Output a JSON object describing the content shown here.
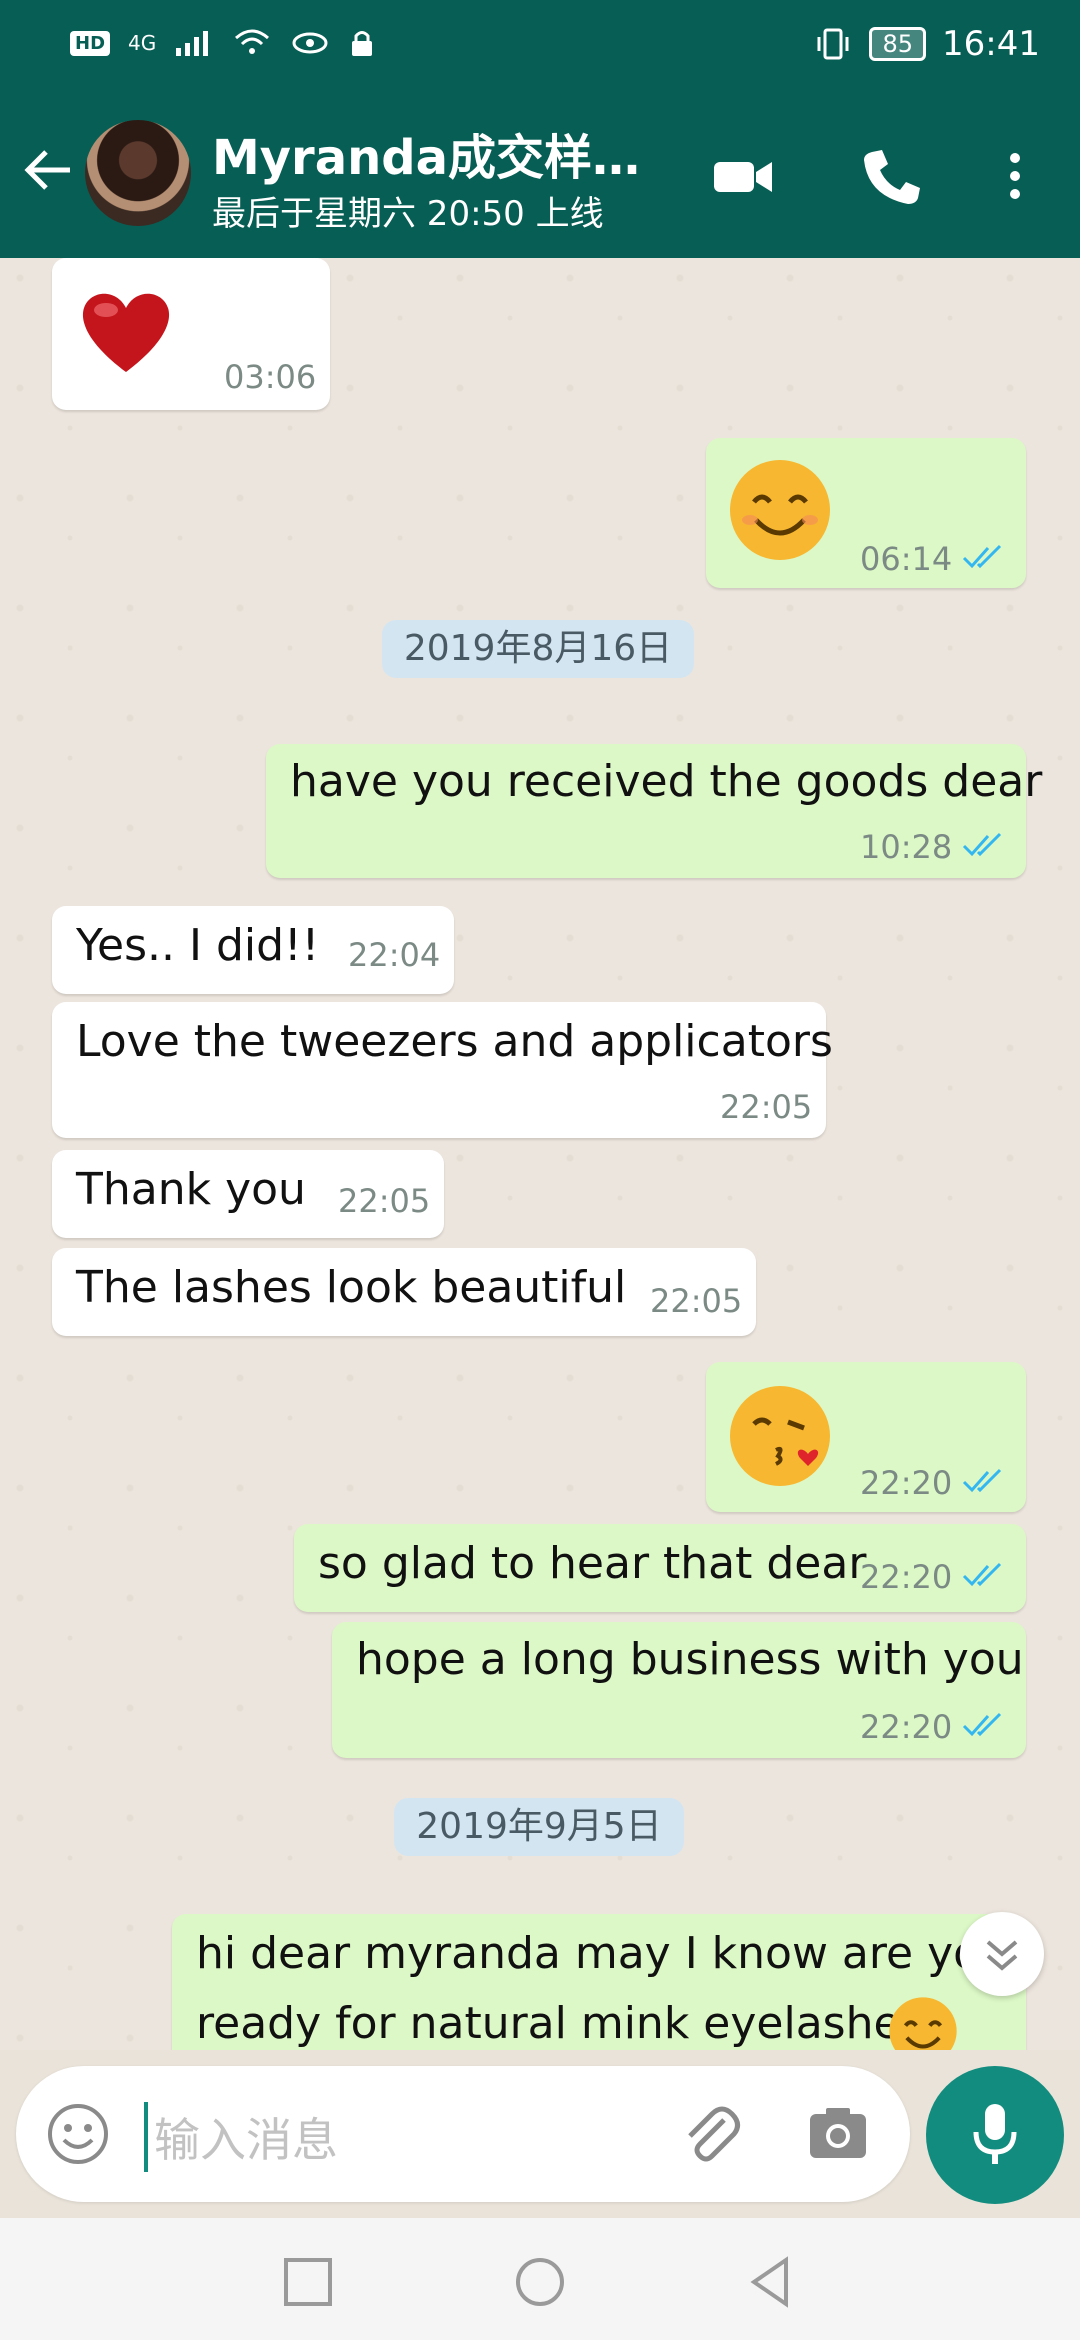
{
  "status": {
    "time": "16:41",
    "battery": "85",
    "hd": "HD",
    "net": "4G"
  },
  "header": {
    "contact_name": "Myranda成交样…",
    "last_seen": "最后于星期六 20:50 上线"
  },
  "messages": [
    {
      "dir": "in",
      "emoji": "heart",
      "time": "03:06"
    },
    {
      "dir": "out",
      "emoji": "smile",
      "time": "06:14"
    },
    {
      "date": "2019年8月16日"
    },
    {
      "dir": "out",
      "text": "have you received the goods dear",
      "time": "10:28"
    },
    {
      "dir": "in",
      "text": "Yes.. I did!!",
      "time": "22:04"
    },
    {
      "dir": "in",
      "text": "Love the tweezers and applicators",
      "time": "22:05"
    },
    {
      "dir": "in",
      "text": "Thank you",
      "time": "22:05"
    },
    {
      "dir": "in",
      "text": "The lashes look beautiful",
      "time": "22:05"
    },
    {
      "dir": "out",
      "emoji": "kiss",
      "time": "22:20"
    },
    {
      "dir": "out",
      "text": "so glad to hear that dear",
      "time": "22:20"
    },
    {
      "dir": "out",
      "text": "hope a long business with you",
      "time": "22:20"
    },
    {
      "date": "2019年9月5日"
    },
    {
      "dir": "out",
      "text1": "hi dear myranda may I know are you",
      "text2": "ready for natural mink eyelashes"
    }
  ],
  "input": {
    "placeholder": "输入消息"
  },
  "colors": {
    "header": "#075e54",
    "outgoing": "#dcf8c6",
    "incoming": "#ffffff",
    "accent": "#128c7e",
    "tick": "#34b7f1"
  },
  "icons": [
    "back-arrow-icon",
    "video-call-icon",
    "phone-icon",
    "more-vert-icon",
    "emoji-icon",
    "attach-icon",
    "camera-icon",
    "mic-icon",
    "scroll-down-icon",
    "nav-recent-icon",
    "nav-home-icon",
    "nav-back-icon"
  ]
}
